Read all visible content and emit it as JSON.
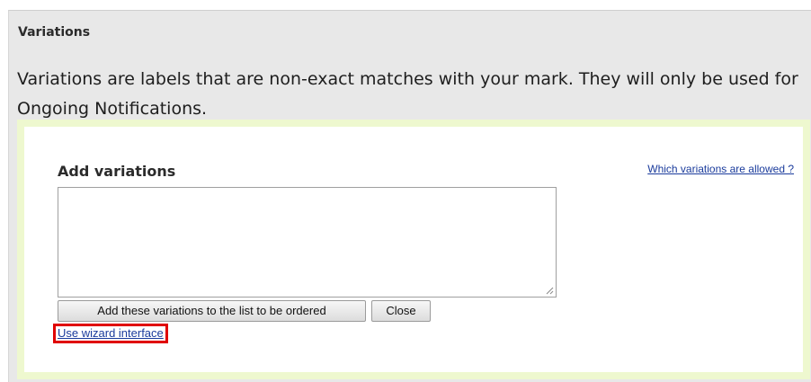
{
  "section": {
    "title": "Variations",
    "description": "Variations are labels that are non-exact matches with your mark. They will only be used for Ongoing Notifications."
  },
  "add_variations": {
    "label": "Add variations",
    "help_link": "Which variations are allowed ?",
    "textarea_value": "",
    "add_button": "Add these variations to the list to be ordered",
    "close_button": "Close",
    "wizard_link": "Use wizard interface"
  },
  "colors": {
    "panel_background": "#e8e8e8",
    "highlight_border": "#eef8cf",
    "link": "#1a3b9c",
    "annotation_highlight": "#e00000"
  }
}
